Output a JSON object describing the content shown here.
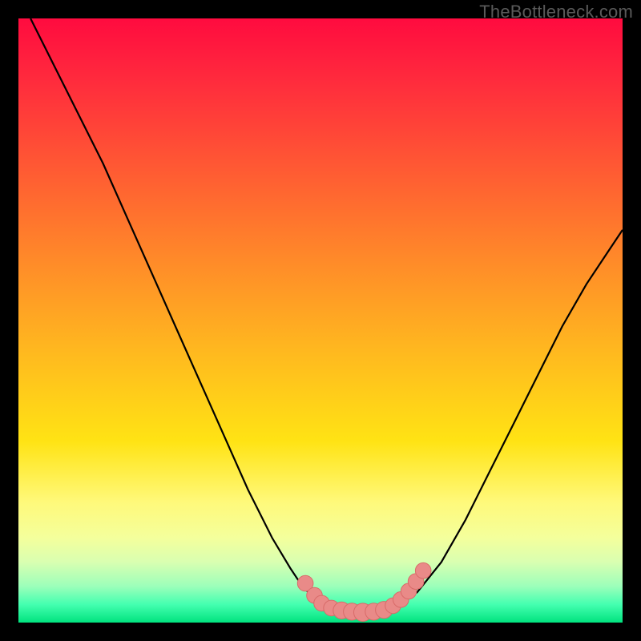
{
  "watermark": "TheBottleneck.com",
  "colors": {
    "frame": "#000000",
    "curve_stroke": "#000000",
    "marker_fill": "#e98a88",
    "marker_stroke": "#d86b69",
    "gradient_top": "#ff0b3f",
    "gradient_bottom": "#00e37e"
  },
  "chart_data": {
    "type": "line",
    "title": "",
    "xlabel": "",
    "ylabel": "",
    "xlim": [
      0,
      100
    ],
    "ylim": [
      0,
      100
    ],
    "grid": false,
    "series": [
      {
        "name": "left-descent",
        "x": [
          2,
          6,
          10,
          14,
          18,
          22,
          26,
          30,
          34,
          38,
          42,
          45,
          47,
          49,
          51
        ],
        "y": [
          100,
          92,
          84,
          76,
          67,
          58,
          49,
          40,
          31,
          22,
          14,
          9,
          6,
          4,
          3
        ]
      },
      {
        "name": "valley",
        "x": [
          51,
          53,
          55,
          57,
          59,
          61,
          63
        ],
        "y": [
          3,
          2.1,
          1.7,
          1.6,
          1.7,
          2.2,
          3.2
        ]
      },
      {
        "name": "right-ascent",
        "x": [
          63,
          66,
          70,
          74,
          78,
          82,
          86,
          90,
          94,
          98,
          100
        ],
        "y": [
          3.2,
          5,
          10,
          17,
          25,
          33,
          41,
          49,
          56,
          62,
          65
        ]
      }
    ],
    "markers": [
      {
        "x": 47.5,
        "y": 6.5,
        "r": 1.3
      },
      {
        "x": 49.0,
        "y": 4.5,
        "r": 1.3
      },
      {
        "x": 50.2,
        "y": 3.2,
        "r": 1.3
      },
      {
        "x": 51.8,
        "y": 2.4,
        "r": 1.3
      },
      {
        "x": 53.5,
        "y": 2.0,
        "r": 1.4
      },
      {
        "x": 55.2,
        "y": 1.8,
        "r": 1.4
      },
      {
        "x": 57.0,
        "y": 1.7,
        "r": 1.5
      },
      {
        "x": 58.8,
        "y": 1.8,
        "r": 1.4
      },
      {
        "x": 60.5,
        "y": 2.1,
        "r": 1.4
      },
      {
        "x": 62.0,
        "y": 2.8,
        "r": 1.3
      },
      {
        "x": 63.3,
        "y": 3.8,
        "r": 1.3
      },
      {
        "x": 64.6,
        "y": 5.2,
        "r": 1.3
      },
      {
        "x": 65.8,
        "y": 6.8,
        "r": 1.3
      },
      {
        "x": 67.0,
        "y": 8.6,
        "r": 1.3
      }
    ],
    "annotations": [
      {
        "text": "TheBottleneck.com",
        "pos": "top-right"
      }
    ]
  }
}
